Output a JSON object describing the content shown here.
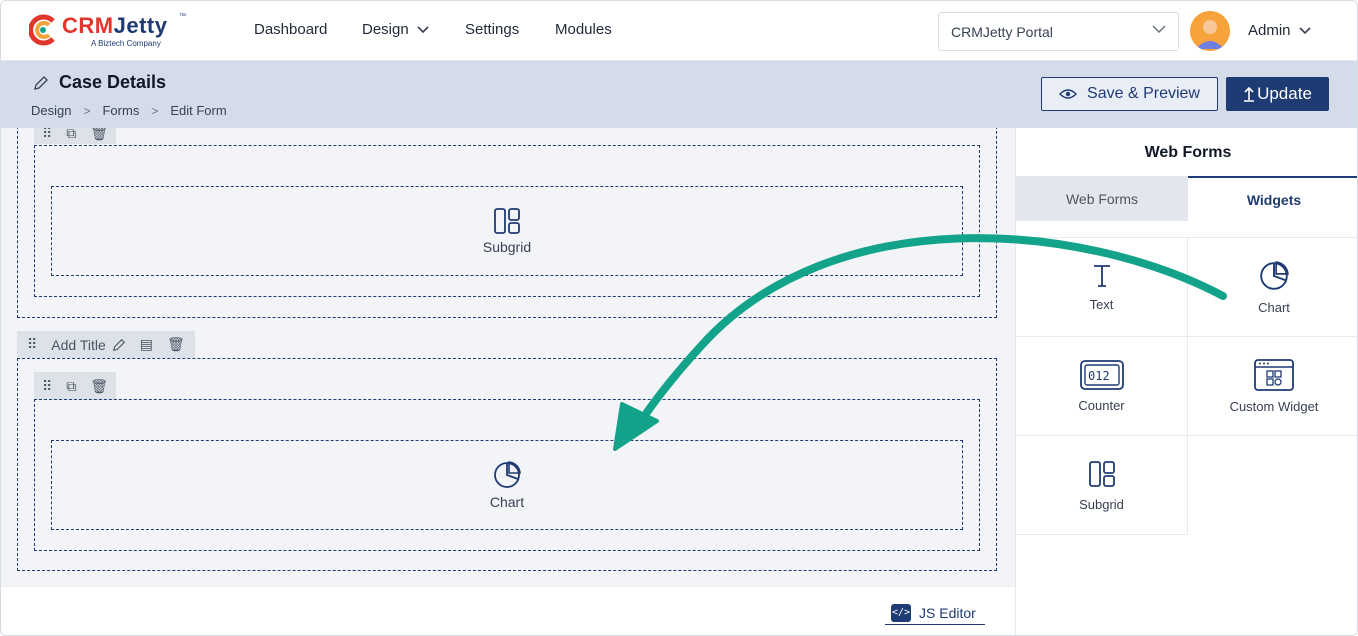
{
  "nav": {
    "logo": {
      "brand_a": "CRM",
      "brand_b": "Jetty",
      "tm": "™",
      "tagline": "A Biztech Company"
    },
    "items": [
      {
        "label": "Dashboard"
      },
      {
        "label": "Design"
      },
      {
        "label": "Settings"
      },
      {
        "label": "Modules"
      }
    ],
    "portal_select": {
      "value": "CRMJetty Portal"
    },
    "user": {
      "name": "Admin"
    }
  },
  "header": {
    "title": "Case Details",
    "breadcrumb": [
      "Design",
      "Forms",
      "Edit Form"
    ],
    "save_preview_label": "Save & Preview",
    "update_label": "Update"
  },
  "canvas": {
    "section1_widget_label": "Subgrid",
    "section2_title": "Add Title",
    "section2_widget_label": "Chart"
  },
  "footer": {
    "js_editor_label": "JS Editor",
    "js_editor_icon": "</>"
  },
  "panel": {
    "title": "Web Forms",
    "tabs": [
      {
        "label": "Web Forms",
        "active": false
      },
      {
        "label": "Widgets",
        "active": true
      }
    ],
    "widgets": [
      {
        "label": "Text",
        "icon": "text-icon"
      },
      {
        "label": "Chart",
        "icon": "pie-chart-icon"
      },
      {
        "label": "Counter",
        "icon": "counter-icon"
      },
      {
        "label": "Custom Widget",
        "icon": "custom-widget-icon"
      },
      {
        "label": "Subgrid",
        "icon": "subgrid-icon"
      }
    ]
  },
  "colors": {
    "primary": "#1f3b73",
    "header_band": "#d4dcea",
    "arrow": "#13a38a",
    "canvas_bg": "#f3f4f8"
  }
}
